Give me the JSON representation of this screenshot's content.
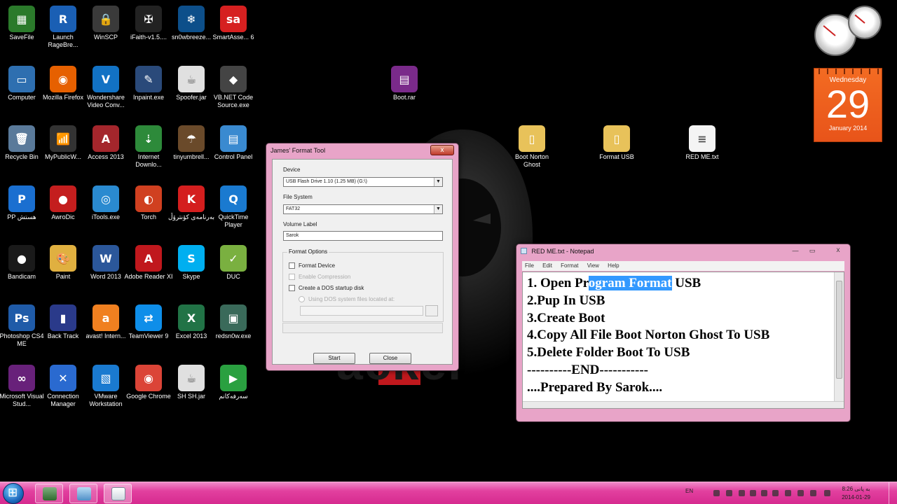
{
  "desktop_icons": [
    {
      "label": "SaveFile",
      "color": "#2b7a2b",
      "glyph": "▦"
    },
    {
      "label": "Launch RageBre...",
      "color": "#1a5fb4",
      "glyph": "R"
    },
    {
      "label": "WinSCP",
      "color": "#3a3a3a",
      "glyph": "🔒"
    },
    {
      "label": "iFaith-v1.5....",
      "color": "#222222",
      "glyph": "✠"
    },
    {
      "label": "sn0wbreeze...",
      "color": "#0d4f8a",
      "glyph": "❄"
    },
    {
      "label": "SmartAsse... 6",
      "color": "#d62020",
      "glyph": "sa"
    },
    {
      "label": "Computer",
      "color": "#2e6fb0",
      "glyph": "▭"
    },
    {
      "label": "Mozilla Firefox",
      "color": "#e66000",
      "glyph": "◉"
    },
    {
      "label": "Wondershare Video Conv...",
      "color": "#1272c4",
      "glyph": "V"
    },
    {
      "label": "Inpaint.exe",
      "color": "#2a4a7a",
      "glyph": "✎"
    },
    {
      "label": "Spoofer.jar",
      "color": "#e0e0e0",
      "glyph": "☕"
    },
    {
      "label": "VB.NET Code Source.exe",
      "color": "#444444",
      "glyph": "◆"
    },
    {
      "label": "Recycle Bin",
      "color": "#5a7a9a",
      "glyph": "🗑"
    },
    {
      "label": "MyPublicW...",
      "color": "#333333",
      "glyph": "📶"
    },
    {
      "label": "Access 2013",
      "color": "#a4262c",
      "glyph": "A"
    },
    {
      "label": "Internet Downlo...",
      "color": "#2d8a3a",
      "glyph": "⇣"
    },
    {
      "label": "tinyumbrell...",
      "color": "#6a4a2a",
      "glyph": "☂"
    },
    {
      "label": "Control Panel",
      "color": "#3a8ad0",
      "glyph": "▤"
    },
    {
      "label": "PP هستش",
      "color": "#1a6fd0",
      "glyph": "P"
    },
    {
      "label": "AwroDic",
      "color": "#c41e1e",
      "glyph": "●"
    },
    {
      "label": "iTools.exe",
      "color": "#2a8ad0",
      "glyph": "◎"
    },
    {
      "label": "Torch",
      "color": "#d04020",
      "glyph": "◐"
    },
    {
      "label": "بەرنامەی کۆنترۆڵ",
      "color": "#d41e1e",
      "glyph": "K"
    },
    {
      "label": "QuickTime Player",
      "color": "#1a7ad0",
      "glyph": "Q"
    },
    {
      "label": "Bandicam",
      "color": "#1a1a1a",
      "glyph": "●"
    },
    {
      "label": "Paint",
      "color": "#e0b040",
      "glyph": "🎨"
    },
    {
      "label": "Word 2013",
      "color": "#2b579a",
      "glyph": "W"
    },
    {
      "label": "Adobe Reader XI",
      "color": "#c0181d",
      "glyph": "A"
    },
    {
      "label": "Skype",
      "color": "#00aff0",
      "glyph": "S"
    },
    {
      "label": "DUC",
      "color": "#7ab040",
      "glyph": "✓"
    },
    {
      "label": "Photoshop CS4 ME",
      "color": "#1f5ba8",
      "glyph": "Ps"
    },
    {
      "label": "Back Track",
      "color": "#2a3a8a",
      "glyph": "▮"
    },
    {
      "label": "avast! Intern...",
      "color": "#f08020",
      "glyph": "a"
    },
    {
      "label": "TeamViewer 9",
      "color": "#0e8ee9",
      "glyph": "⇄"
    },
    {
      "label": "Excel 2013",
      "color": "#217346",
      "glyph": "X"
    },
    {
      "label": "redsn0w.exe",
      "color": "#3a6a5a",
      "glyph": "▣"
    },
    {
      "label": "Microsoft Visual Stud...",
      "color": "#68217a",
      "glyph": "∞"
    },
    {
      "label": "Connection Manager",
      "color": "#2a6ad0",
      "glyph": "✕"
    },
    {
      "label": "VMware Workstation",
      "color": "#1a7ad0",
      "glyph": "▧"
    },
    {
      "label": "Google Chrome",
      "color": "#db4437",
      "glyph": "◉"
    },
    {
      "label": "SH SH.jar",
      "color": "#e0e0e0",
      "glyph": "☕"
    },
    {
      "label": "سەرفەکانم",
      "color": "#2aa040",
      "glyph": "▶"
    }
  ],
  "desktop_files": [
    {
      "label": "Boot.rar",
      "color": "#7a2a8a",
      "glyph": "▤"
    },
    {
      "label": "Boot Norton Ghost",
      "color": "#e8c25a",
      "glyph": "▯"
    },
    {
      "label": "Format USB",
      "color": "#e8c25a",
      "glyph": "▯"
    },
    {
      "label": "RED ME.txt",
      "color": "#f4f4f4",
      "glyph": "≡"
    }
  ],
  "wallpaper": {
    "text": "ackel"
  },
  "calendar": {
    "weekday": "Wednesday",
    "day": "29",
    "month_year": "January 2014"
  },
  "format_tool": {
    "title": "James' Format Tool",
    "device_label": "Device",
    "device_value": "USB Flash Drive 1.10 (1.25 MB) (G:\\)",
    "filesystem_label": "File System",
    "filesystem_value": "FAT32",
    "volume_label": "Volume Label",
    "volume_value": "Sarok",
    "options_group": "Format Options",
    "opt_format_device": "Format Device",
    "opt_compression": "Enable Compression",
    "opt_dos_disk": "Create a DOS startup disk",
    "opt_dos_files": "Using DOS system files located at:",
    "start_button": "Start",
    "close_button": "Close",
    "close_x": "x"
  },
  "notepad": {
    "title": "RED ME.txt - Notepad",
    "menu": [
      "File",
      "Edit",
      "Format",
      "View",
      "Help"
    ],
    "line1_pre": "1. Open Pr",
    "line1_sel": "ogram Format",
    "line1_post": " USB",
    "lines": [
      "2.Pup In USB",
      "3.Create Boot",
      "4.Copy All File Boot Norton Ghost To USB",
      "5.Delete Folder Boot To USB",
      "----------END-----------",
      "....Prepared By Sarok...."
    ],
    "close_x": "x"
  },
  "taskbar": {
    "lang": "EN",
    "clock_day": "به پانی",
    "clock_time": "8:26",
    "clock_date": "2014-01-29"
  }
}
